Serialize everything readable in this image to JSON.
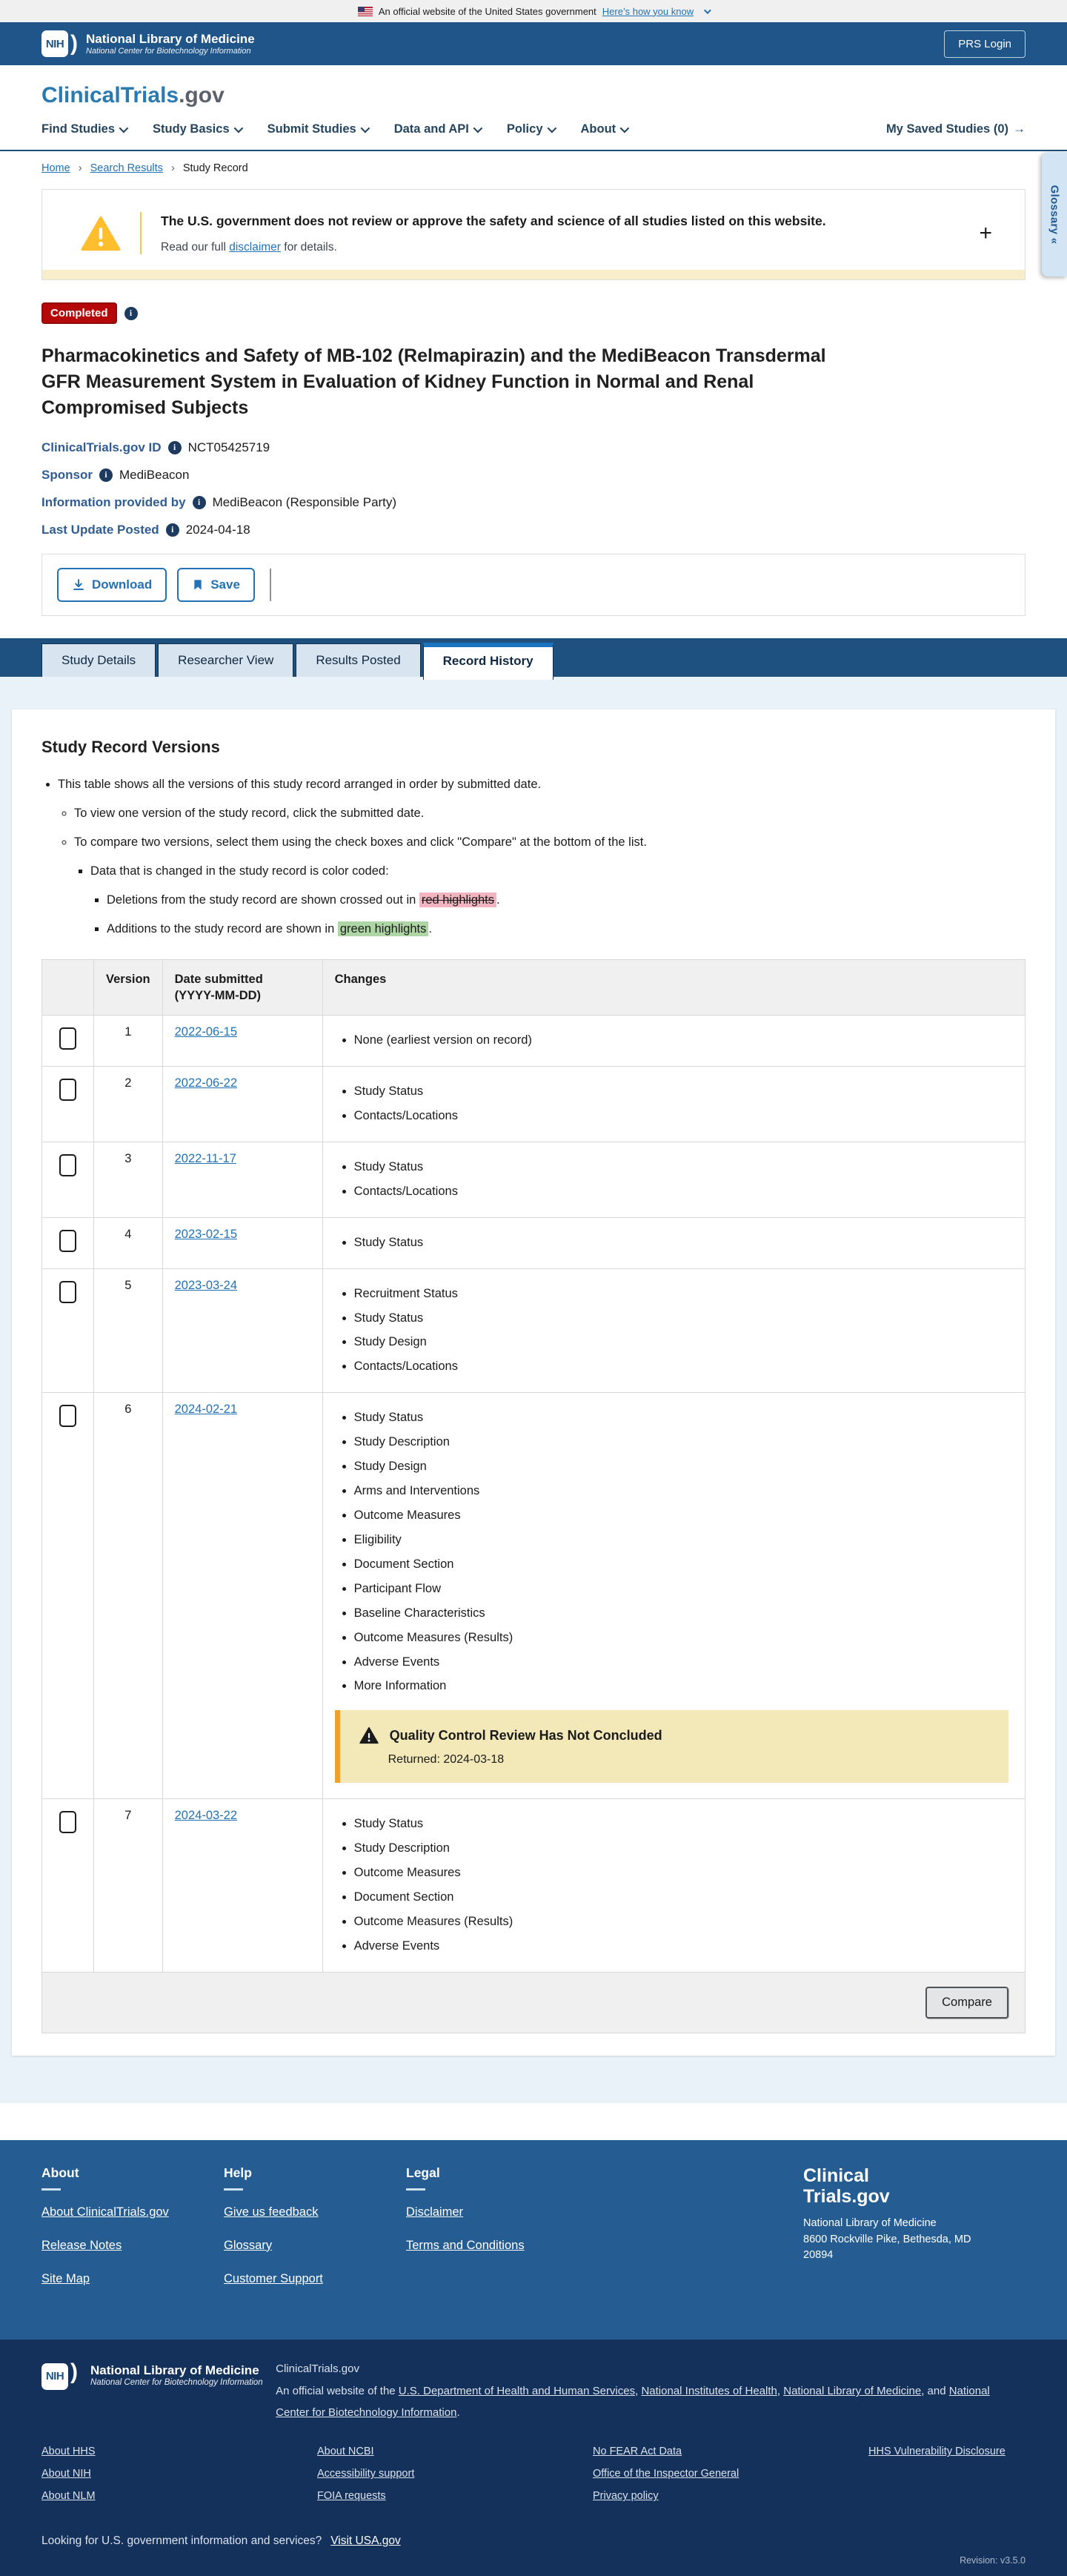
{
  "banner": {
    "text": "An official website of the United States government",
    "link": "Here’s how you know"
  },
  "header": {
    "nih_acronym": "NIH",
    "org": "National Library of Medicine",
    "suborg": "National Center for Biotechnology Information",
    "login": "PRS Login"
  },
  "masthead": {
    "brand": "ClinicalTrials",
    "brand_suffix": ".gov"
  },
  "nav": {
    "items": [
      {
        "label": "Find Studies"
      },
      {
        "label": "Study Basics"
      },
      {
        "label": "Submit Studies"
      },
      {
        "label": "Data and API"
      },
      {
        "label": "Policy"
      },
      {
        "label": "About"
      }
    ],
    "saved": "My Saved Studies (0)",
    "saved_arrow": "→"
  },
  "breadcrumb": {
    "home": "Home",
    "search": "Search Results",
    "current": "Study Record",
    "sep": "›"
  },
  "glossary": {
    "label": "Glossary «"
  },
  "warning": {
    "heading": "The U.S. government does not review or approve the safety and science of all studies listed on this website.",
    "body_prefix": "Read our full ",
    "link": "disclaimer",
    "body_suffix": " for details.",
    "expand": "+"
  },
  "study": {
    "status": "Completed",
    "title": "Pharmacokinetics and Safety of MB-102 (Relmapirazin) and the MediBeacon Transdermal GFR Measurement System in Evaluation of Kidney Function in Normal and Renal Compromised Subjects",
    "meta": [
      {
        "label": "ClinicalTrials.gov ID",
        "value": "NCT05425719"
      },
      {
        "label": "Sponsor",
        "value": "MediBeacon"
      },
      {
        "label": "Information provided by",
        "value": "MediBeacon (Responsible Party)"
      },
      {
        "label": "Last Update Posted",
        "value": "2024-04-18"
      }
    ]
  },
  "actions": {
    "download": "Download",
    "save": "Save"
  },
  "tabs": [
    {
      "label": "Study Details"
    },
    {
      "label": "Researcher View"
    },
    {
      "label": "Results Posted"
    },
    {
      "label": "Record History"
    }
  ],
  "versions": {
    "heading": "Study Record Versions",
    "intro": {
      "line1": "This table shows all the versions of this study record arranged in order by submitted date.",
      "line2": "To view one version of the study record, click the submitted date.",
      "line3": "To compare two versions, select them using the check boxes and click \"Compare\" at the bottom of the list.",
      "line4": "Data that is changed in the study record is color coded:",
      "deletions_prefix": "Deletions from the study record are shown crossed out in ",
      "deletions_highlight": "red highlights",
      "deletions_suffix": ".",
      "additions_prefix": "Additions to the study record are shown in ",
      "additions_highlight": "green highlights",
      "additions_suffix": "."
    },
    "table": {
      "header_version": "Version",
      "header_date_line1": "Date submitted",
      "header_date_line2": "(YYYY-MM-DD)",
      "header_changes": "Changes",
      "rows": [
        {
          "version": "1",
          "date": "2022-06-15",
          "changes": [
            "None (earliest version on record)"
          ]
        },
        {
          "version": "2",
          "date": "2022-06-22",
          "changes": [
            "Study Status",
            "Contacts/Locations"
          ]
        },
        {
          "version": "3",
          "date": "2022-11-17",
          "changes": [
            "Study Status",
            "Contacts/Locations"
          ]
        },
        {
          "version": "4",
          "date": "2023-02-15",
          "changes": [
            "Study Status"
          ]
        },
        {
          "version": "5",
          "date": "2023-03-24",
          "changes": [
            "Recruitment Status",
            "Study Status",
            "Study Design",
            "Contacts/Locations"
          ]
        },
        {
          "version": "6",
          "date": "2024-02-21",
          "changes": [
            "Study Status",
            "Study Description",
            "Study Design",
            "Arms and Interventions",
            "Outcome Measures",
            "Eligibility",
            "Document Section",
            "Participant Flow",
            "Baseline Characteristics",
            "Outcome Measures (Results)",
            "Adverse Events",
            "More Information"
          ],
          "alert": {
            "title": "Quality Control Review Has Not Concluded",
            "returned": "Returned: 2024-03-18"
          }
        },
        {
          "version": "7",
          "date": "2024-03-22",
          "changes": [
            "Study Status",
            "Study Description",
            "Outcome Measures",
            "Document Section",
            "Outcome Measures (Results)",
            "Adverse Events"
          ]
        }
      ]
    },
    "compare": "Compare"
  },
  "footer": {
    "columns": [
      {
        "heading": "About",
        "links": [
          "About ClinicalTrials.gov",
          "Release Notes",
          "Site Map"
        ]
      },
      {
        "heading": "Help",
        "links": [
          "Give us feedback",
          "Glossary",
          "Customer Support"
        ]
      },
      {
        "heading": "Legal",
        "links": [
          "Disclaimer",
          "Terms and Conditions"
        ]
      }
    ],
    "brand_line1": "Clinical",
    "brand_line2": "Trials.gov",
    "address_line1": "National Library of Medicine",
    "address_line2": "8600 Rockville Pike, Bethesda, MD",
    "address_line3": "20894"
  },
  "subfooter": {
    "nih_acronym": "NIH",
    "org": "National Library of Medicine",
    "suborg": "National Center for Biotechnology Information",
    "site": "ClinicalTrials.gov",
    "desc_prefix": "An official website of the ",
    "link1": "U.S. Department of Health and Human Services",
    "join1": ", ",
    "link2": "National Institutes of Health",
    "join2": ", ",
    "link3": "National Library of Medicine",
    "join3": ", and ",
    "link4": "National Center for Biotechnology Information",
    "join4": ".",
    "grid": {
      "c1": [
        "About HHS",
        "About NIH",
        "About NLM"
      ],
      "c2": [
        "About NCBI",
        "Accessibility support",
        "FOIA requests"
      ],
      "c3": [
        "No FEAR Act Data",
        "Office of the Inspector General",
        "Privacy policy"
      ],
      "c4": [
        "HHS Vulnerability Disclosure"
      ]
    },
    "looking": "Looking for U.S. government information and services?",
    "usa_link": "Visit USA.gov",
    "revision": "Revision: v3.5.0"
  },
  "colors": {
    "accent_blue": "#2272b5",
    "header_blue": "#20558a",
    "footer_blue": "#255d93",
    "dark_footer": "#14315c",
    "badge_red": "#b50909",
    "alert_bg": "#f3e8b7",
    "alert_bar": "#efa12d",
    "highlight_red": "#f2b4c0",
    "highlight_green": "#aed6a4"
  }
}
